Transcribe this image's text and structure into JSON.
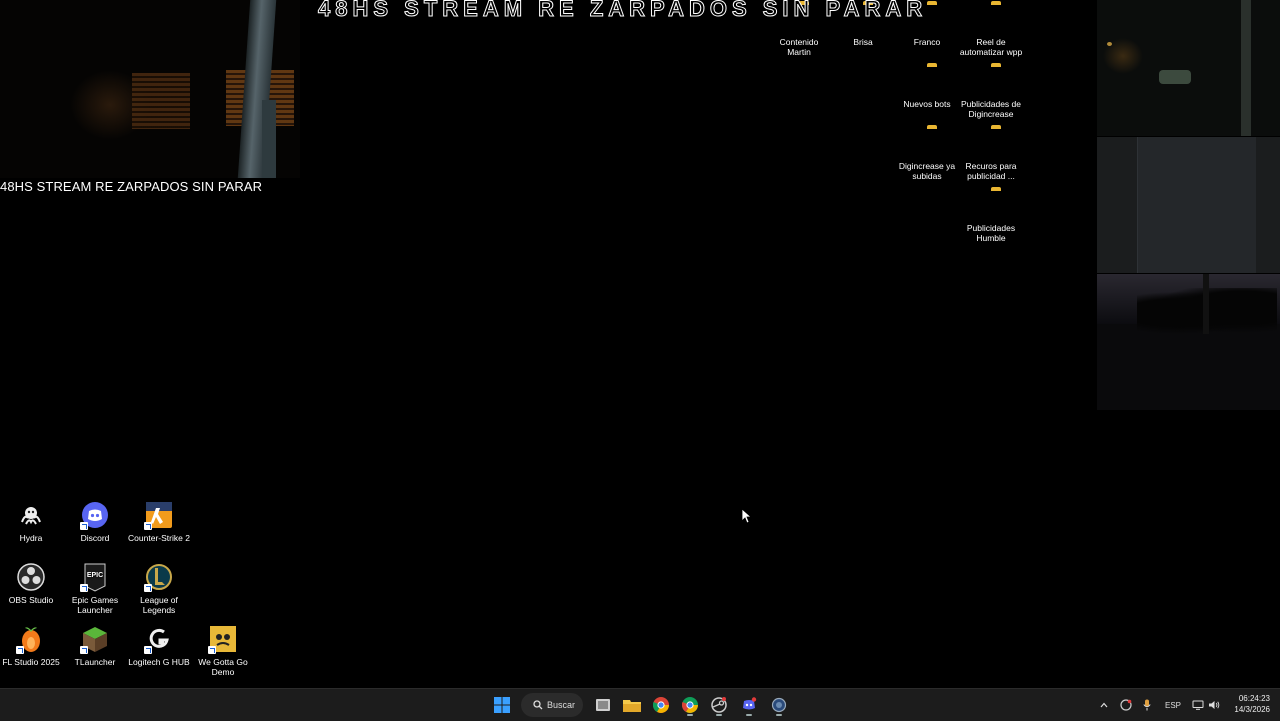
{
  "overlay": {
    "marquee_text": "48HS STREAM RE ZARPADOS SIN PARAR",
    "caption_text": "48HS STREAM RE ZARPADOS SIN PARAR"
  },
  "desktop": {
    "top_icons": [
      {
        "label": "Contenido Martin",
        "icon": "folder-icon"
      },
      {
        "label": "Brisa",
        "icon": "folder-icon"
      },
      {
        "label": "Franco",
        "icon": "folder-icon"
      },
      {
        "label": "Reel de automatizar wpp",
        "icon": "folder-icon"
      },
      {
        "label": "Nuevos bots",
        "icon": "folder-icon"
      },
      {
        "label": "Publicidades de Digincrease",
        "icon": "folder-icon"
      },
      {
        "label": "Digincrease ya subidas",
        "icon": "folder-icon"
      },
      {
        "label": "Recuros para publicidad ...",
        "icon": "folder-icon"
      },
      {
        "label": "Publicidades Humble",
        "icon": "folder-icon"
      }
    ],
    "bottom_icons": [
      {
        "label": "Hydra",
        "icon": "hydra-icon"
      },
      {
        "label": "Discord",
        "icon": "discord-icon"
      },
      {
        "label": "Counter-Strike 2",
        "icon": "counter-strike-icon"
      },
      {
        "label": "OBS Studio",
        "icon": "obs-icon"
      },
      {
        "label": "Epic Games Launcher",
        "icon": "epic-games-icon"
      },
      {
        "label": "League of Legends",
        "icon": "league-of-legends-icon"
      },
      {
        "label": "FL Studio 2025",
        "icon": "fl-studio-icon"
      },
      {
        "label": "TLauncher",
        "icon": "tlauncher-icon"
      },
      {
        "label": "Logitech G HUB",
        "icon": "logitech-icon"
      },
      {
        "label": "We Gotta Go Demo",
        "icon": "we-gotta-go-icon"
      }
    ]
  },
  "taskbar": {
    "search_label": "Buscar",
    "pinned": [
      "windows-start-icon",
      "search-icon",
      "task-view-icon",
      "file-explorer-icon",
      "chrome-icon",
      "chrome-profile-icon",
      "steam-icon",
      "discord-icon",
      "app-icon"
    ],
    "tray": {
      "language": "ESP",
      "time": "06:24:23",
      "date": "14/3/2026"
    }
  },
  "colors": {
    "folder": "#f4c94a",
    "taskbar": "#1c1c1c",
    "windows_blue": "#3aa0ff",
    "discord": "#5865f2"
  }
}
